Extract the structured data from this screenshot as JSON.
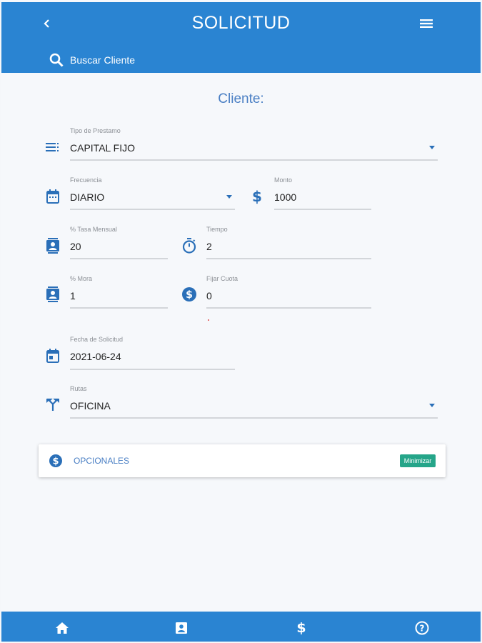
{
  "header": {
    "title": "SOLICITUD",
    "search_label": "Buscar Cliente"
  },
  "section_title": "Cliente:",
  "form": {
    "tipo_prestamo": {
      "label": "Tipo de Prestamo",
      "value": "CAPITAL FIJO"
    },
    "frecuencia": {
      "label": "Frecuencia",
      "value": "DIARIO"
    },
    "monto": {
      "label": "Monto",
      "value": "1000"
    },
    "tasa_mensual": {
      "label": "% Tasa Mensual",
      "value": "20"
    },
    "tiempo": {
      "label": "Tiempo",
      "value": "2"
    },
    "mora": {
      "label": "% Mora",
      "value": "1"
    },
    "fijar_cuota": {
      "label": "Fijar Cuota",
      "value": "0"
    },
    "fecha_solicitud": {
      "label": "Fecha de Solicitud",
      "value": "2021-06-24"
    },
    "rutas": {
      "label": "Rutas",
      "value": "OFICINA"
    }
  },
  "opcionales": {
    "label": "OPCIONALES",
    "button": "Minimizar"
  },
  "colors": {
    "primary": "#2a84d2",
    "accent_text": "#4a7fc4",
    "button_green": "#25a589"
  },
  "icons": {
    "back": "chevron-left-icon",
    "menu": "hamburger-menu-icon",
    "search": "search-icon",
    "tipo": "list-icon",
    "frecuencia": "calendar-icon",
    "monto": "dollar-icon",
    "tasa": "contact-card-icon",
    "tiempo": "timer-icon",
    "mora": "contact-card-icon",
    "cuota": "dollar-circle-icon",
    "fecha": "calendar-event-icon",
    "rutas": "call-split-icon",
    "footer": [
      "home-icon",
      "contact-card-icon",
      "dollar-icon",
      "help-circle-icon"
    ]
  }
}
